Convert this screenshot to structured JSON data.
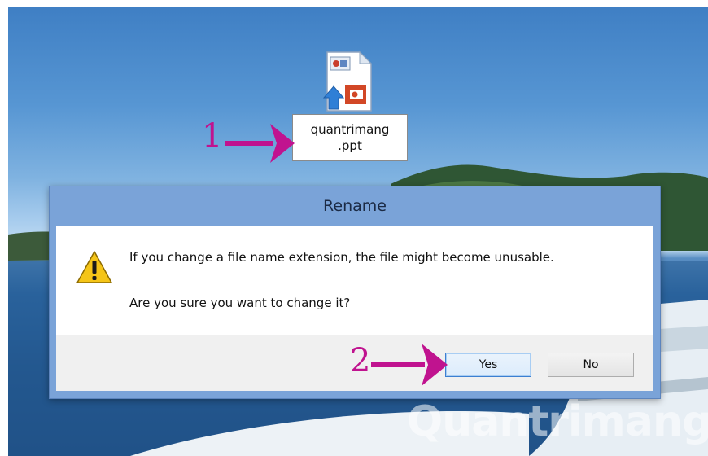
{
  "desktop": {
    "file_icon": "powerpoint-file-icon",
    "file_label_line1": "quantrimang",
    "file_label_line2": ".ppt"
  },
  "annotations": {
    "step1": "1",
    "step2": "2",
    "arrow_color": "#c0138f"
  },
  "dialog": {
    "title": "Rename",
    "icon": "warning-icon",
    "message": "If you change a file name extension, the file might become unusable.",
    "question": "Are you sure you want to change it?",
    "yes_label": "Yes",
    "no_label": "No"
  },
  "watermark": {
    "text": "uantrimang"
  }
}
